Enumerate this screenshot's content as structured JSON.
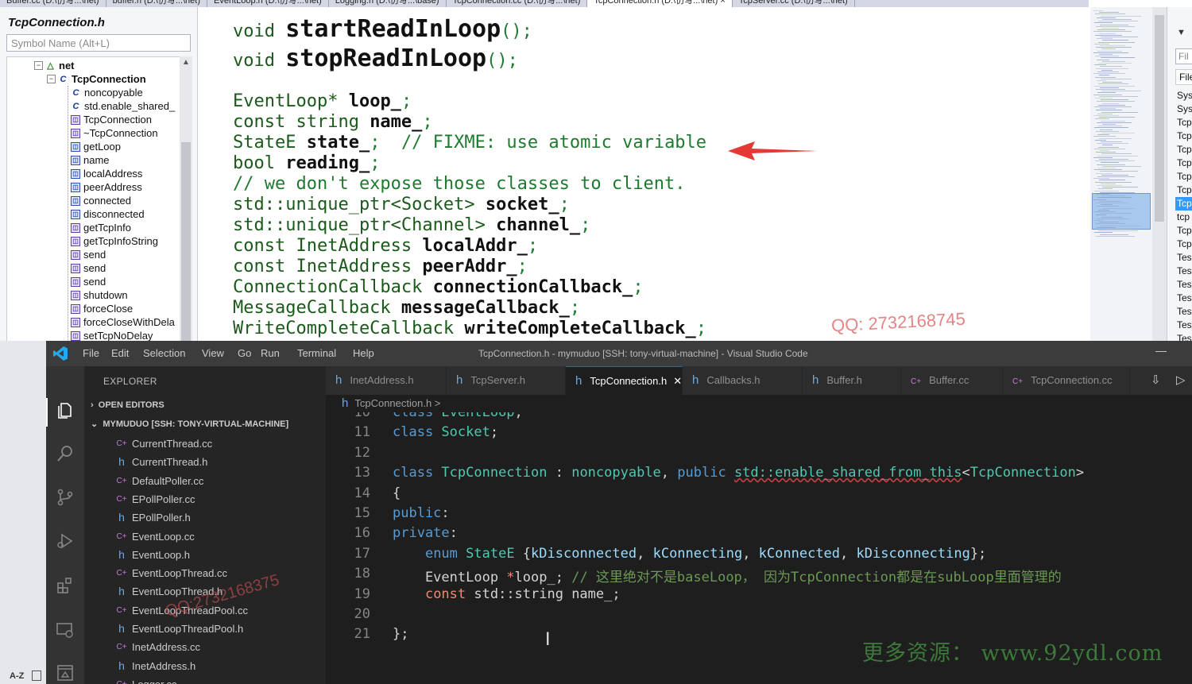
{
  "vs_tabs": [
    {
      "label": "Buffer.cc (D:\\仿写...\\net)"
    },
    {
      "label": "buffer.h (D:\\仿写...\\net)"
    },
    {
      "label": "EventLoop.h (D:\\仿写...\\net)"
    },
    {
      "label": "Logging.h (D:\\仿写...\\base)"
    },
    {
      "label": "TcpConnection.cc (D:\\仿写...\\net)"
    },
    {
      "label": "TcpConnection.h (D:\\仿写...\\net) ×",
      "active": true
    },
    {
      "label": "TcpServer.cc (D:\\仿写...\\net)"
    }
  ],
  "class_view": {
    "title": "TcpConnection.h",
    "search_placeholder": "Symbol Name (Alt+L)",
    "tree": [
      {
        "label": "net",
        "type": "ns",
        "box": "−"
      },
      {
        "label": "TcpConnection",
        "type": "cls",
        "box": "−"
      },
      {
        "label": "noncopyable",
        "type": "base"
      },
      {
        "label": "std.enable_shared_",
        "type": "base"
      },
      {
        "label": "TcpConnection",
        "type": "ctor"
      },
      {
        "label": "~TcpConnection",
        "type": "ctor"
      },
      {
        "label": "getLoop",
        "type": "meth"
      },
      {
        "label": "name",
        "type": "meth"
      },
      {
        "label": "localAddress",
        "type": "meth"
      },
      {
        "label": "peerAddress",
        "type": "meth"
      },
      {
        "label": "connected",
        "type": "meth"
      },
      {
        "label": "disconnected",
        "type": "meth"
      },
      {
        "label": "getTcpInfo",
        "type": "ctor"
      },
      {
        "label": "getTcpInfoString",
        "type": "ctor"
      },
      {
        "label": "send",
        "type": "ctor"
      },
      {
        "label": "send",
        "type": "ctor"
      },
      {
        "label": "send",
        "type": "ctor"
      },
      {
        "label": "shutdown",
        "type": "ctor"
      },
      {
        "label": "forceClose",
        "type": "ctor"
      },
      {
        "label": "forceCloseWithDela",
        "type": "ctor"
      },
      {
        "label": "setTcpNoDelay",
        "type": "ctor"
      }
    ]
  },
  "vs_code": {
    "l1": {
      "kw": "void ",
      "name": "startReadInLoop",
      "tail": "();"
    },
    "l2": {
      "kw": "void ",
      "name": "stopReadInLoop",
      "tail": "();"
    },
    "l3": {
      "kw": "EventLoop* ",
      "name": "loop_",
      "tail": ";"
    },
    "l4": {
      "kw": "const string ",
      "name": "name_",
      "tail": ";"
    },
    "l5": {
      "kw": "StateE ",
      "name": "state_",
      "tail": ";  // FIXME: use atomic variable"
    },
    "l6": {
      "kw": "bool ",
      "name": "reading_",
      "tail": ";"
    },
    "l7": {
      "comment": "// we don't expose those classes to client."
    },
    "l8": {
      "kw": "std::unique_ptr<Socket> ",
      "name": "socket_",
      "tail": ";"
    },
    "l9": {
      "kw": "std::unique_ptr<Channel> ",
      "name": "channel_",
      "tail": ";"
    },
    "l10": {
      "kw": "const InetAddress ",
      "name": "localAddr_",
      "tail": ";"
    },
    "l11": {
      "kw": "const InetAddress ",
      "name": "peerAddr_",
      "tail": ";"
    },
    "l12": {
      "kw": "ConnectionCallback ",
      "name": "connectionCallback_",
      "tail": ";"
    },
    "l13": {
      "kw": "MessageCallback ",
      "name": "messageCallback_",
      "tail": ";"
    },
    "l14": {
      "kw": "WriteCompleteCallback ",
      "name": "writeCompleteCallback_",
      "tail": ";"
    },
    "watermark": "QQ: 2732168745"
  },
  "sol_explorer": {
    "filter": "Fil",
    "header": "File",
    "items": [
      "Sys",
      "Sys",
      "Tcp",
      "Tcp",
      "Tcp",
      "Tcp",
      "Tcp",
      "Tcp",
      "Tcp",
      "tcp",
      "Tcp",
      "Tcp",
      "Tes",
      "Tes",
      "Tes",
      "Tes",
      "Tes",
      "Tes",
      "Tes"
    ],
    "selected_index": 8
  },
  "vscode": {
    "menu": [
      "File",
      "Edit",
      "Selection",
      "View",
      "Go",
      "Run",
      "Terminal",
      "Help"
    ],
    "window_title": "TcpConnection.h - mymuduo [SSH: tony-virtual-machine] - Visual Studio Code",
    "explorer_title": "EXPLORER",
    "open_editors": "OPEN EDITORS",
    "workspace": "MYMUDUO [SSH: TONY-VIRTUAL-MACHINE]",
    "files": [
      {
        "name": "CurrentThread.cc",
        "kind": "cc"
      },
      {
        "name": "CurrentThread.h",
        "kind": "h"
      },
      {
        "name": "DefaultPoller.cc",
        "kind": "cc"
      },
      {
        "name": "EPollPoller.cc",
        "kind": "cc"
      },
      {
        "name": "EPollPoller.h",
        "kind": "h"
      },
      {
        "name": "EventLoop.cc",
        "kind": "cc"
      },
      {
        "name": "EventLoop.h",
        "kind": "h"
      },
      {
        "name": "EventLoopThread.cc",
        "kind": "cc"
      },
      {
        "name": "EventLoopThread.h",
        "kind": "h"
      },
      {
        "name": "EventLoopThreadPool.cc",
        "kind": "cc"
      },
      {
        "name": "EventLoopThreadPool.h",
        "kind": "h"
      },
      {
        "name": "InetAddress.cc",
        "kind": "cc"
      },
      {
        "name": "InetAddress.h",
        "kind": "h"
      },
      {
        "name": "Logger.cc",
        "kind": "cc"
      }
    ],
    "sidebar_watermark": "QQ:2732168375",
    "tabs": [
      {
        "name": "InetAddress.h",
        "kind": "h"
      },
      {
        "name": "TcpServer.h",
        "kind": "h"
      },
      {
        "name": "TcpConnection.h",
        "kind": "h",
        "active": true
      },
      {
        "name": "Callbacks.h",
        "kind": "h"
      },
      {
        "name": "Buffer.h",
        "kind": "h"
      },
      {
        "name": "Buffer.cc",
        "kind": "cc"
      },
      {
        "name": "TcpConnection.cc",
        "kind": "cc"
      }
    ],
    "breadcrumb": "TcpConnection.h >",
    "code_lines": [
      {
        "num": "10",
        "parts": [
          {
            "c": "k",
            "t": "class "
          },
          {
            "c": "ty",
            "t": "EventLoop"
          },
          {
            "c": "",
            "t": ";"
          }
        ]
      },
      {
        "num": "11",
        "parts": [
          {
            "c": "k",
            "t": "class "
          },
          {
            "c": "ty",
            "t": "Socket"
          },
          {
            "c": "",
            "t": ";"
          }
        ]
      },
      {
        "num": "12",
        "parts": []
      },
      {
        "num": "13",
        "parts": [
          {
            "c": "k",
            "t": "class "
          },
          {
            "c": "ty",
            "t": "TcpConnection"
          },
          {
            "c": "",
            "t": " : "
          },
          {
            "c": "ty",
            "t": "noncopyable"
          },
          {
            "c": "",
            "t": ", "
          },
          {
            "c": "k",
            "t": "public "
          },
          {
            "c": "ty sq",
            "t": "std::enable_shared_from_this"
          },
          {
            "c": "",
            "t": "<"
          },
          {
            "c": "ty",
            "t": "TcpConnection"
          },
          {
            "c": "",
            "t": ">"
          }
        ]
      },
      {
        "num": "14",
        "parts": [
          {
            "c": "",
            "t": "{"
          }
        ]
      },
      {
        "num": "15",
        "parts": [
          {
            "c": "k",
            "t": "public"
          },
          {
            "c": "",
            "t": ":"
          }
        ]
      },
      {
        "num": "16",
        "parts": [
          {
            "c": "k",
            "t": "private"
          },
          {
            "c": "",
            "t": ":"
          }
        ]
      },
      {
        "num": "17",
        "parts": [
          {
            "c": "",
            "t": "    "
          },
          {
            "c": "k",
            "t": "enum "
          },
          {
            "c": "ty",
            "t": "StateE"
          },
          {
            "c": "",
            "t": " {"
          },
          {
            "c": "en",
            "t": "kDisconnected"
          },
          {
            "c": "",
            "t": ", "
          },
          {
            "c": "en",
            "t": "kConnecting"
          },
          {
            "c": "",
            "t": ", "
          },
          {
            "c": "en",
            "t": "kConnected"
          },
          {
            "c": "",
            "t": ", "
          },
          {
            "c": "en",
            "t": "kDisconnecting"
          },
          {
            "c": "",
            "t": "};"
          }
        ]
      },
      {
        "num": "18",
        "parts": [
          {
            "c": "",
            "t": "    EventLoop "
          },
          {
            "c": "kr",
            "t": "*"
          },
          {
            "c": "",
            "t": "loop_; "
          },
          {
            "c": "cm2",
            "t": "// 这里绝对不是baseLoop， 因为TcpConnection都是在subLoop里面管理的"
          }
        ]
      },
      {
        "num": "19",
        "parts": [
          {
            "c": "",
            "t": "    "
          },
          {
            "c": "kr",
            "t": "const "
          },
          {
            "c": "",
            "t": "std::string name_;"
          }
        ]
      },
      {
        "num": "20",
        "parts": []
      },
      {
        "num": "21",
        "parts": [
          {
            "c": "",
            "t": "};"
          }
        ]
      }
    ],
    "promo": "更多资源： www.92ydl.com"
  },
  "colors": {
    "vscode_accent": "#007acc",
    "arrow": "#e53935",
    "vs_keyword_green": "#1e7a2e"
  }
}
